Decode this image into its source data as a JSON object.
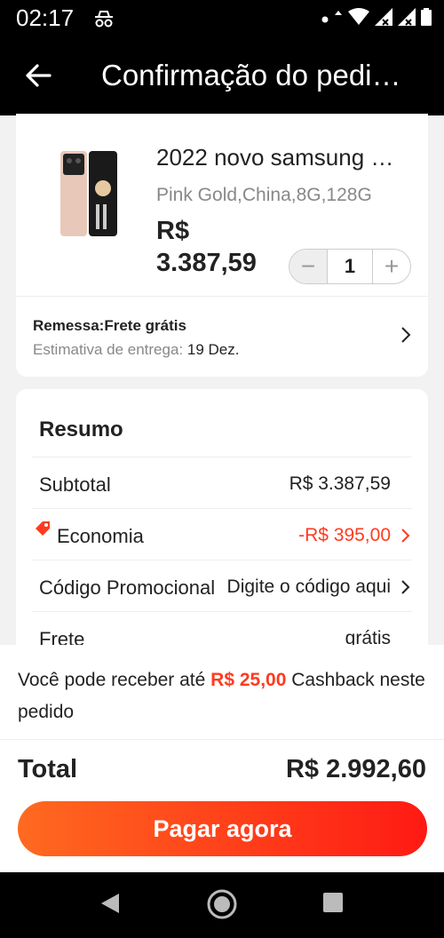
{
  "status_bar": {
    "time": "02:17"
  },
  "header": {
    "title": "Confirmação do pedi…"
  },
  "product": {
    "name": "2022 novo samsung …",
    "variant": "Pink Gold,China,8G,128G",
    "currency": "R$",
    "price": "3.387,59",
    "quantity": "1",
    "minus_label": "−",
    "plus_label": "+",
    "shipping_title": "Remessa:Frete grátis",
    "delivery_label": "Estimativa de entrega: ",
    "delivery_date": "19 Dez."
  },
  "summary": {
    "title": "Resumo",
    "subtotal_label": "Subtotal",
    "subtotal_value": "R$ 3.387,59",
    "economy_label": "Economia",
    "economy_value": "-R$ 395,00",
    "promo_label": "Código Promocional",
    "promo_value": "Digite o código aqui",
    "shipping_label": "Frete",
    "shipping_value": "grátis"
  },
  "bottom": {
    "cashback_pre": "Você pode receber até ",
    "cashback_amount": "R$ 25,00",
    "cashback_post": " Cashback neste pedido",
    "total_label": "Total",
    "total_value": "R$ 2.992,60",
    "pay_label": "Pagar agora"
  },
  "colors": {
    "accent": "#ff3b1f",
    "header_bg": "#000000"
  }
}
